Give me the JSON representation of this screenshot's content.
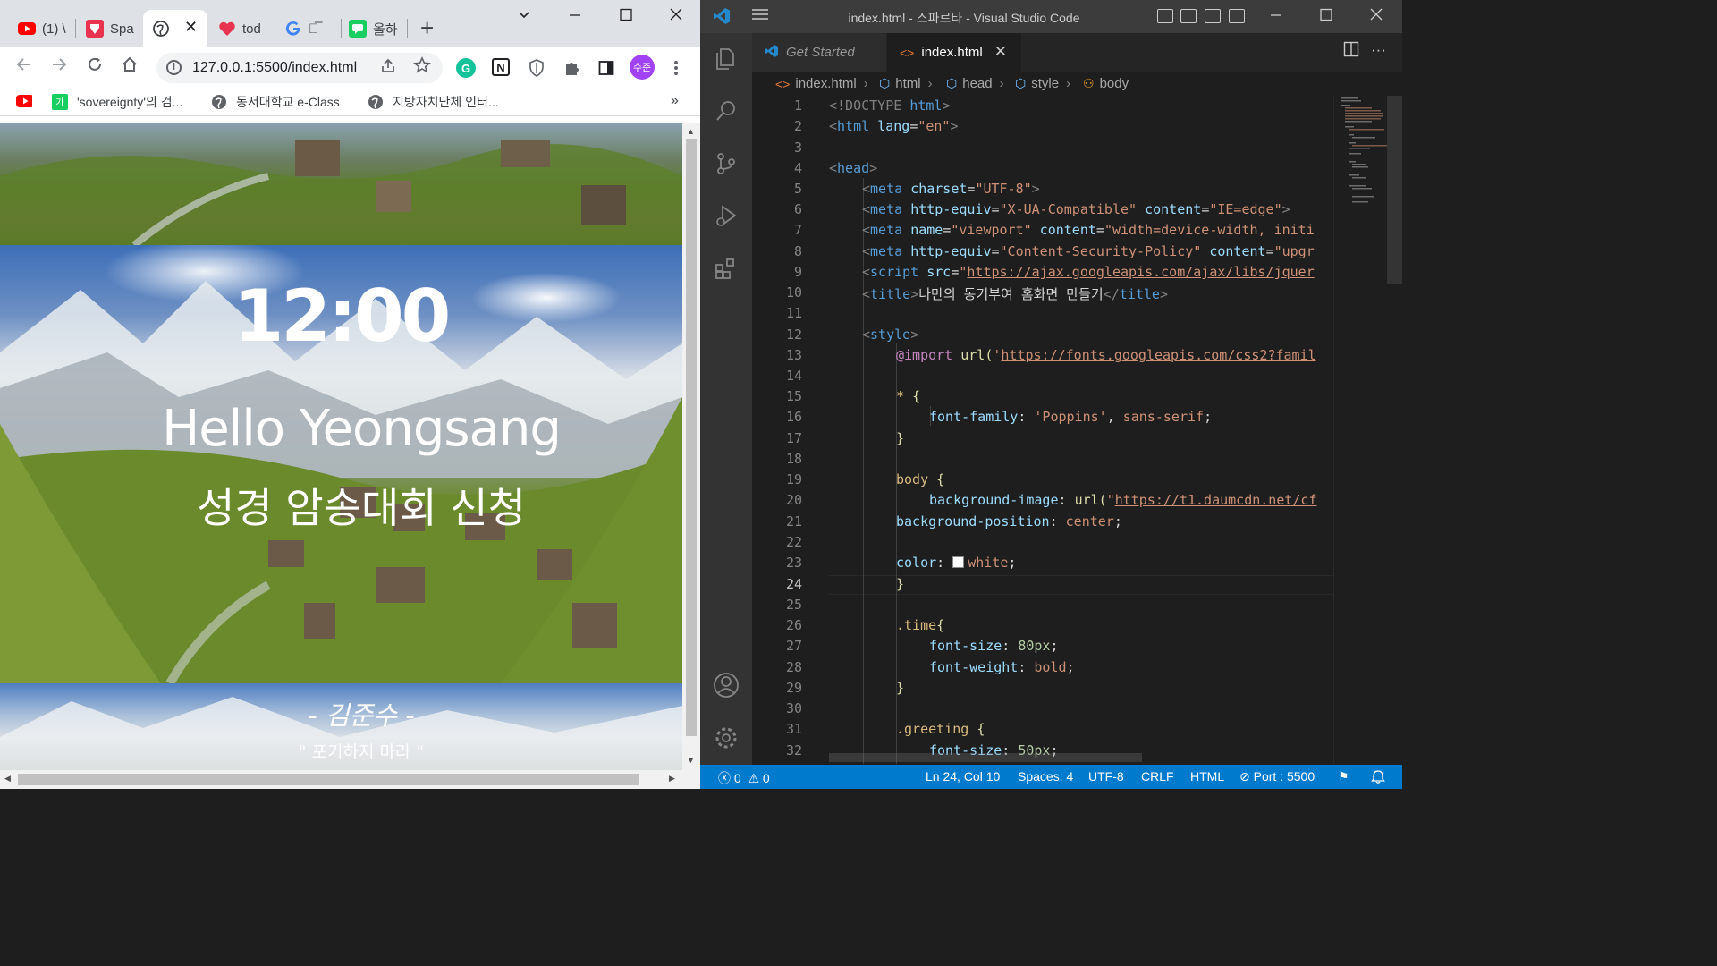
{
  "chrome": {
    "tabs": [
      {
        "label": "(1) \\",
        "favicon": "youtube-icon"
      },
      {
        "label": "Spa",
        "favicon": "sparta-icon"
      },
      {
        "label": "",
        "favicon": "globe-icon",
        "active": true
      },
      {
        "label": "tod",
        "favicon": "heart-icon"
      },
      {
        "label": "그̅",
        "favicon": "google-icon"
      },
      {
        "label": "올하",
        "favicon": "chat-icon"
      }
    ],
    "tab_close": "✕",
    "new_tab": "+",
    "url": "127.0.0.1:5500/index.html",
    "profile_initials": "수준",
    "bookmarks": [
      {
        "label": "",
        "icon": "youtube-icon"
      },
      {
        "label": "'sovereignty'의 검...",
        "icon": "naver-dict-icon"
      },
      {
        "label": "동서대학교 e-Class",
        "icon": "globe-icon"
      },
      {
        "label": "지방자치단체 인터...",
        "icon": "globe-icon"
      }
    ],
    "bookmarks_more": "»"
  },
  "page": {
    "time": "12:00",
    "greeting": "Hello Yeongsang",
    "subtitle": "성경 암송대회 신청",
    "author": "- 김준수 -",
    "quote": "\" 포기하지 마라 \""
  },
  "vscode": {
    "window_title": "index.html - 스파르타 - Visual Studio Code",
    "tabs": [
      {
        "label": "Get Started"
      },
      {
        "label": "index.html",
        "active": true
      }
    ],
    "breadcrumb": [
      "index.html",
      "html",
      "head",
      "style",
      "body"
    ],
    "line_numbers": [
      "1",
      "2",
      "3",
      "4",
      "5",
      "6",
      "7",
      "8",
      "9",
      "10",
      "11",
      "12",
      "13",
      "14",
      "15",
      "16",
      "17",
      "18",
      "19",
      "20",
      "21",
      "22",
      "23",
      "24",
      "25",
      "26",
      "27",
      "28",
      "29",
      "30",
      "31",
      "32"
    ],
    "current_line": "24",
    "code": {
      "l1_a": "<!DOCTYPE ",
      "l1_b": "html",
      "l1_c": ">",
      "l2_a": "<",
      "l2_b": "html ",
      "l2_c": "lang",
      "l2_d": "=",
      "l2_e": "\"en\"",
      "l2_f": ">",
      "l4_a": "<",
      "l4_b": "head",
      "l4_c": ">",
      "l5_a": "<",
      "l5_b": "meta ",
      "l5_c": "charset",
      "l5_d": "=",
      "l5_e": "\"UTF-8\"",
      "l5_f": ">",
      "l6_a": "<",
      "l6_b": "meta ",
      "l6_c": "http-equiv",
      "l6_d": "=",
      "l6_e": "\"X-UA-Compatible\" ",
      "l6_f": "content",
      "l6_g": "=",
      "l6_h": "\"IE=edge\"",
      "l6_i": ">",
      "l7_a": "<",
      "l7_b": "meta ",
      "l7_c": "name",
      "l7_d": "=",
      "l7_e": "\"viewport\" ",
      "l7_f": "content",
      "l7_g": "=",
      "l7_h": "\"width=device-width, initi",
      "l8_a": "<",
      "l8_b": "meta ",
      "l8_c": "http-equiv",
      "l8_d": "=",
      "l8_e": "\"Content-Security-Policy\" ",
      "l8_f": "content",
      "l8_g": "=",
      "l8_h": "\"upgr",
      "l9_a": "<",
      "l9_b": "script ",
      "l9_c": "src",
      "l9_d": "=",
      "l9_e": "\"",
      "l9_f": "https://ajax.googleapis.com/ajax/libs/jquer",
      "l10_a": "<",
      "l10_b": "title",
      "l10_c": ">",
      "l10_d": "나만의 동기부여 홈화면 만들기",
      "l10_e": "</",
      "l10_f": "title",
      "l10_g": ">",
      "l12_a": "<",
      "l12_b": "style",
      "l12_c": ">",
      "l13_a": "@import ",
      "l13_b": "url(",
      "l13_c": "'",
      "l13_d": "https://fonts.googleapis.com/css2?famil",
      "l15_a": "* ",
      "l15_b": "{",
      "l16_a": "font-family",
      "l16_b": ": ",
      "l16_c": "'Poppins'",
      "l16_d": ", ",
      "l16_e": "sans-serif",
      "l16_f": ";",
      "l17": "}",
      "l19_a": "body ",
      "l19_b": "{",
      "l20_a": "background-image",
      "l20_b": ": ",
      "l20_c": "url(",
      "l20_d": "\"",
      "l20_e": "https://t1.daumcdn.net/cf",
      "l21_a": "background-position",
      "l21_b": ": ",
      "l21_c": "center",
      "l21_d": ";",
      "l23_a": "color",
      "l23_b": ": ",
      "l23_c": "white",
      "l23_d": ";",
      "l24": "}",
      "l26_a": ".time",
      "l26_b": "{",
      "l27_a": "font-size",
      "l27_b": ": ",
      "l27_c": "80px",
      "l27_d": ";",
      "l28_a": "font-weight",
      "l28_b": ": ",
      "l28_c": "bold",
      "l28_d": ";",
      "l29": "}",
      "l31_a": ".greeting ",
      "l31_b": "{",
      "l32_a": "font-size",
      "l32_b": ": ",
      "l32_c": "50px",
      "l32_d": ";"
    },
    "status": {
      "errors": "0",
      "warnings": "0",
      "position": "Ln 24, Col 10",
      "spaces": "Spaces: 4",
      "encoding": "UTF-8",
      "eol": "CRLF",
      "language": "HTML",
      "port": "Port : 5500"
    },
    "colors": {
      "accent": "#007acc",
      "editor_bg": "#1e1e1e",
      "activity_bg": "#333333"
    }
  }
}
